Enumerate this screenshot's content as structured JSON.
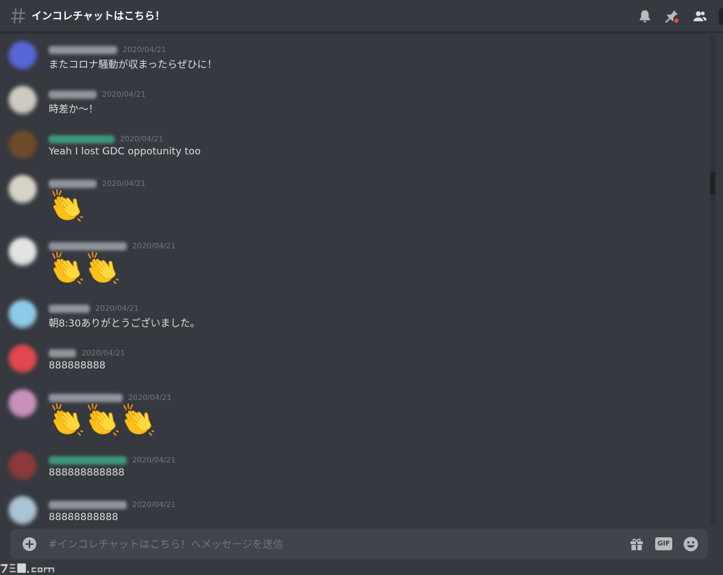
{
  "channel": {
    "title": "インコレチャットはこちら！",
    "hash_icon": "hash-icon"
  },
  "header_buttons": [
    {
      "name": "bell-icon",
      "label": "notifications"
    },
    {
      "name": "pin-icon",
      "label": "pinned messages",
      "badge_color": "#f04747"
    },
    {
      "name": "members-icon",
      "label": "member list"
    }
  ],
  "messages": [
    {
      "timestamp": "2020/04/21",
      "text": "またコロナ騒動が収まったらぜひに！",
      "emoji_count": 0,
      "avatar_color": "#5865d8",
      "name_color": "#a0a4ac"
    },
    {
      "timestamp": "2020/04/21",
      "text": "時差か〜！",
      "emoji_count": 0,
      "avatar_color": "#cfcac0",
      "name_color": "#a0a4ac"
    },
    {
      "timestamp": "2020/04/21",
      "text": "Yeah I lost GDC oppotunity too",
      "emoji_count": 0,
      "avatar_color": "#6e4a2c",
      "name_color": "#3fa88a"
    },
    {
      "timestamp": "2020/04/21",
      "text": "",
      "emoji_count": 1,
      "emoji": "clapping-hands",
      "avatar_color": "#d8d4c8",
      "name_color": "#a0a4ac"
    },
    {
      "timestamp": "2020/04/21",
      "text": "",
      "emoji_count": 2,
      "emoji": "clapping-hands",
      "avatar_color": "#e3e3e3",
      "name_color": "#a0a4ac"
    },
    {
      "timestamp": "2020/04/21",
      "text": "朝8:30ありがとうございました。",
      "emoji_count": 0,
      "avatar_color": "#8ccbe8",
      "name_color": "#a0a4ac"
    },
    {
      "timestamp": "2020/04/21",
      "text": "888888888",
      "emoji_count": 0,
      "avatar_color": "#e0474f",
      "name_color": "#a0a4ac"
    },
    {
      "timestamp": "2020/04/21",
      "text": "",
      "emoji_count": 3,
      "emoji": "clapping-hands",
      "avatar_color": "#c98fbd",
      "name_color": "#a0a4ac"
    },
    {
      "timestamp": "2020/04/21",
      "text": "888888888888",
      "emoji_count": 0,
      "avatar_color": "#8a3a3a",
      "name_color": "#3fa88a"
    },
    {
      "timestamp": "2020/04/21",
      "text": "88888888888",
      "emoji_count": 0,
      "avatar_color": "#a9c4d4",
      "name_color": "#a0a4ac"
    }
  ],
  "composer": {
    "placeholder": "#インコレチャットはこちら！へメッセージを送信",
    "gif_label": "GIF",
    "buttons": [
      "plus-circle-icon",
      "gift-icon",
      "gif-icon",
      "smiley-icon"
    ]
  },
  "watermark": {
    "text": "ファミ通.com"
  },
  "colors": {
    "background": "#36393f",
    "composer": "#40444b",
    "timestamp": "#72767d",
    "text": "#dcddde",
    "header_text": "#ffffff"
  }
}
